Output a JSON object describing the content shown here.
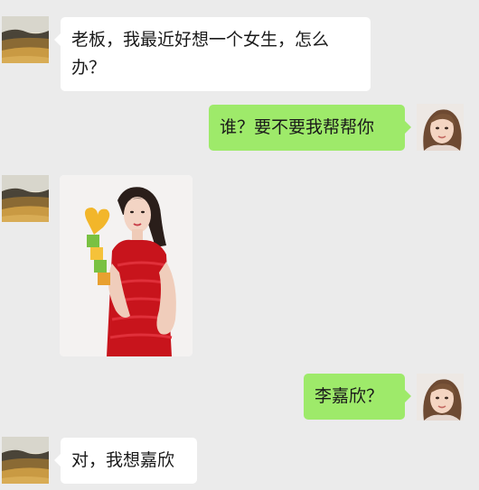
{
  "messages": [
    {
      "side": "left",
      "type": "text",
      "text": "老板，我最近好想一个女生，怎么办？",
      "avatar": "desert-landscape-avatar"
    },
    {
      "side": "right",
      "type": "text",
      "text": "谁？要不要我帮帮你",
      "avatar": "girl-portrait-avatar"
    },
    {
      "side": "left",
      "type": "image",
      "image": "woman-in-red-dress-photo",
      "avatar": "desert-landscape-avatar"
    },
    {
      "side": "right",
      "type": "text",
      "text": "李嘉欣？",
      "avatar": "girl-portrait-avatar"
    },
    {
      "side": "left",
      "type": "text",
      "text": "对，我想嘉欣",
      "avatar": "desert-landscape-avatar"
    }
  ],
  "colors": {
    "background": "#ebebeb",
    "incoming_bubble": "#ffffff",
    "outgoing_bubble": "#9eea6a",
    "text": "#1a1a1a"
  }
}
